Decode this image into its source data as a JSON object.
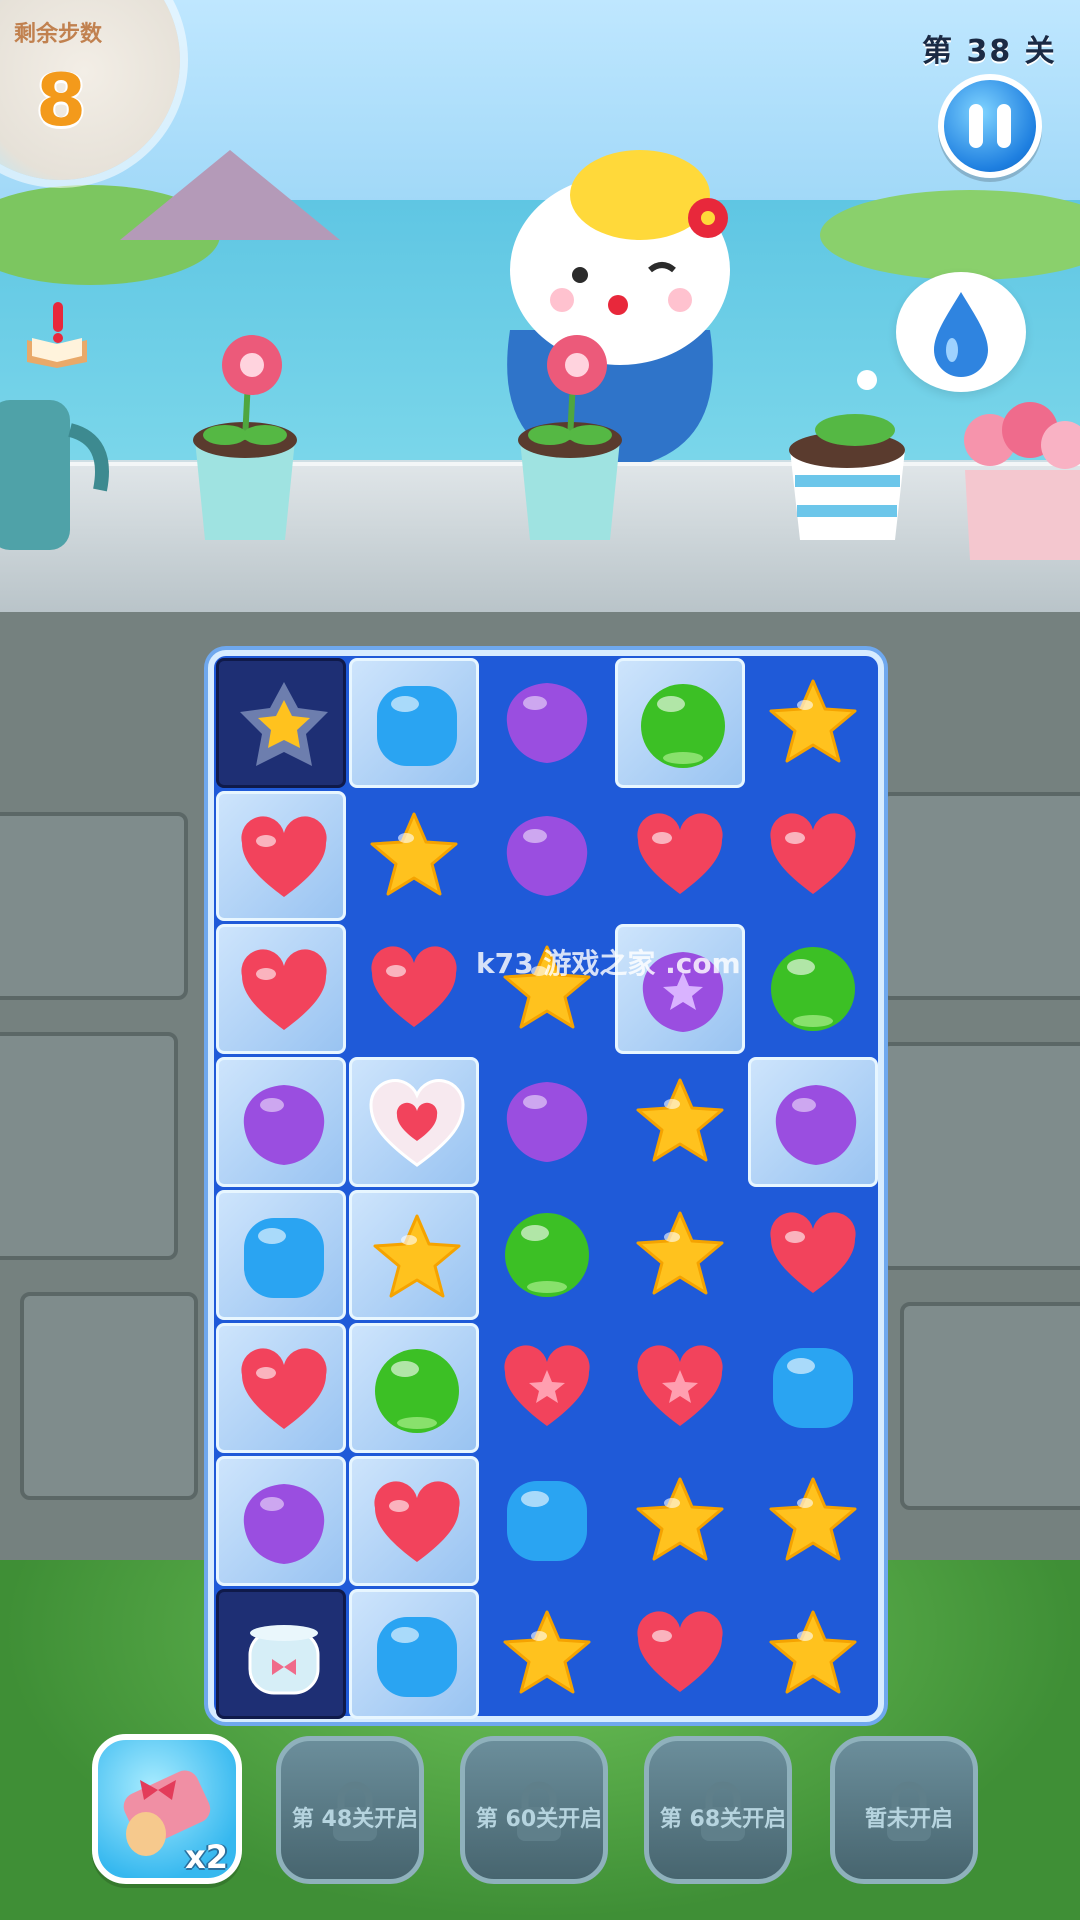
{
  "hud": {
    "moves_label": "剩余步数",
    "moves_count": "8",
    "level_label": "第 38 关"
  },
  "colors": {
    "board": "#1f5ad8",
    "ice": "#cfe8fb",
    "red": "#f2435c",
    "yellow": "#ffc21e",
    "purple": "#9a4ee0",
    "green": "#3cc025",
    "blue": "#2aa4f2"
  },
  "board": {
    "rows": 8,
    "cols": 5,
    "cells": [
      [
        {
          "t": "star-tile",
          "bg": "dark"
        },
        {
          "t": "blue",
          "bg": "ice"
        },
        {
          "t": "purple",
          "bg": "none"
        },
        {
          "t": "green",
          "bg": "ice"
        },
        {
          "t": "yellow",
          "bg": "none"
        }
      ],
      [
        {
          "t": "red",
          "bg": "ice"
        },
        {
          "t": "yellow",
          "bg": "none"
        },
        {
          "t": "purple",
          "bg": "none"
        },
        {
          "t": "red",
          "bg": "none"
        },
        {
          "t": "red",
          "bg": "none"
        }
      ],
      [
        {
          "t": "red",
          "bg": "ice"
        },
        {
          "t": "red",
          "bg": "none"
        },
        {
          "t": "yellow",
          "bg": "none"
        },
        {
          "t": "purple-star",
          "bg": "ice"
        },
        {
          "t": "green",
          "bg": "none"
        }
      ],
      [
        {
          "t": "purple",
          "bg": "ice"
        },
        {
          "t": "heart-bubble",
          "bg": "ice"
        },
        {
          "t": "purple",
          "bg": "none"
        },
        {
          "t": "yellow",
          "bg": "none"
        },
        {
          "t": "purple",
          "bg": "ice"
        }
      ],
      [
        {
          "t": "blue",
          "bg": "ice"
        },
        {
          "t": "yellow",
          "bg": "ice"
        },
        {
          "t": "green",
          "bg": "none"
        },
        {
          "t": "yellow",
          "bg": "none"
        },
        {
          "t": "red",
          "bg": "none"
        }
      ],
      [
        {
          "t": "red",
          "bg": "ice"
        },
        {
          "t": "green",
          "bg": "ice"
        },
        {
          "t": "red-star",
          "bg": "none"
        },
        {
          "t": "red-star",
          "bg": "none"
        },
        {
          "t": "blue",
          "bg": "none"
        }
      ],
      [
        {
          "t": "purple",
          "bg": "ice"
        },
        {
          "t": "red",
          "bg": "ice"
        },
        {
          "t": "blue",
          "bg": "none"
        },
        {
          "t": "yellow",
          "bg": "none"
        },
        {
          "t": "yellow",
          "bg": "none"
        }
      ],
      [
        {
          "t": "jar",
          "bg": "dark"
        },
        {
          "t": "blue",
          "bg": "ice"
        },
        {
          "t": "yellow",
          "bg": "none"
        },
        {
          "t": "red",
          "bg": "none"
        },
        {
          "t": "yellow",
          "bg": "none"
        }
      ]
    ]
  },
  "watermark": "k73 游戏之家 .com",
  "boosters": [
    {
      "icon": "log-bow-icon",
      "count": "x2",
      "locked": false
    },
    {
      "label": "第 48关开启",
      "locked": true
    },
    {
      "label": "第 60关开启",
      "locked": true
    },
    {
      "label": "第 68关开启",
      "locked": true
    },
    {
      "label": "暂未开启",
      "locked": true
    }
  ]
}
